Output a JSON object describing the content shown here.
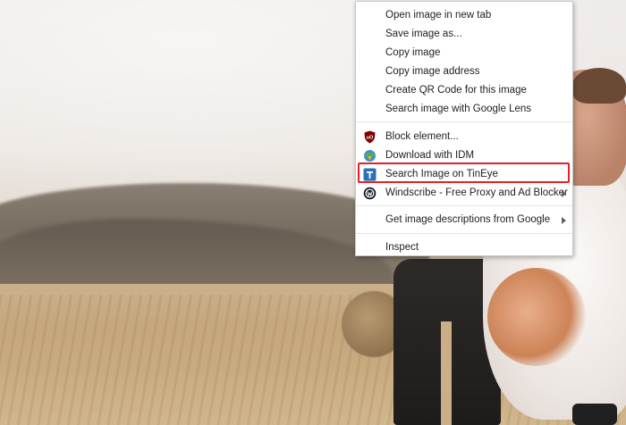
{
  "background": {
    "description": "blurred-photo"
  },
  "context_menu": {
    "items": [
      {
        "label": "Open image in new tab"
      },
      {
        "label": "Save image as..."
      },
      {
        "label": "Copy image"
      },
      {
        "label": "Copy image address"
      },
      {
        "label": "Create QR Code for this image"
      },
      {
        "label": "Search image with Google Lens"
      },
      {
        "label": "Block element...",
        "icon": "ublock-origin-icon"
      },
      {
        "label": "Download with IDM",
        "icon": "idm-icon"
      },
      {
        "label": "Search Image on TinEye",
        "icon": "tineye-icon",
        "highlighted": true
      },
      {
        "label": "Windscribe - Free Proxy and Ad Blocker",
        "icon": "windscribe-icon",
        "submenu": true
      },
      {
        "label": "Get image descriptions from Google",
        "submenu": true
      },
      {
        "label": "Inspect"
      }
    ],
    "colors": {
      "highlight_border": "#e32129",
      "ublock": "#800000",
      "tineye": "#2e6fb7"
    }
  }
}
